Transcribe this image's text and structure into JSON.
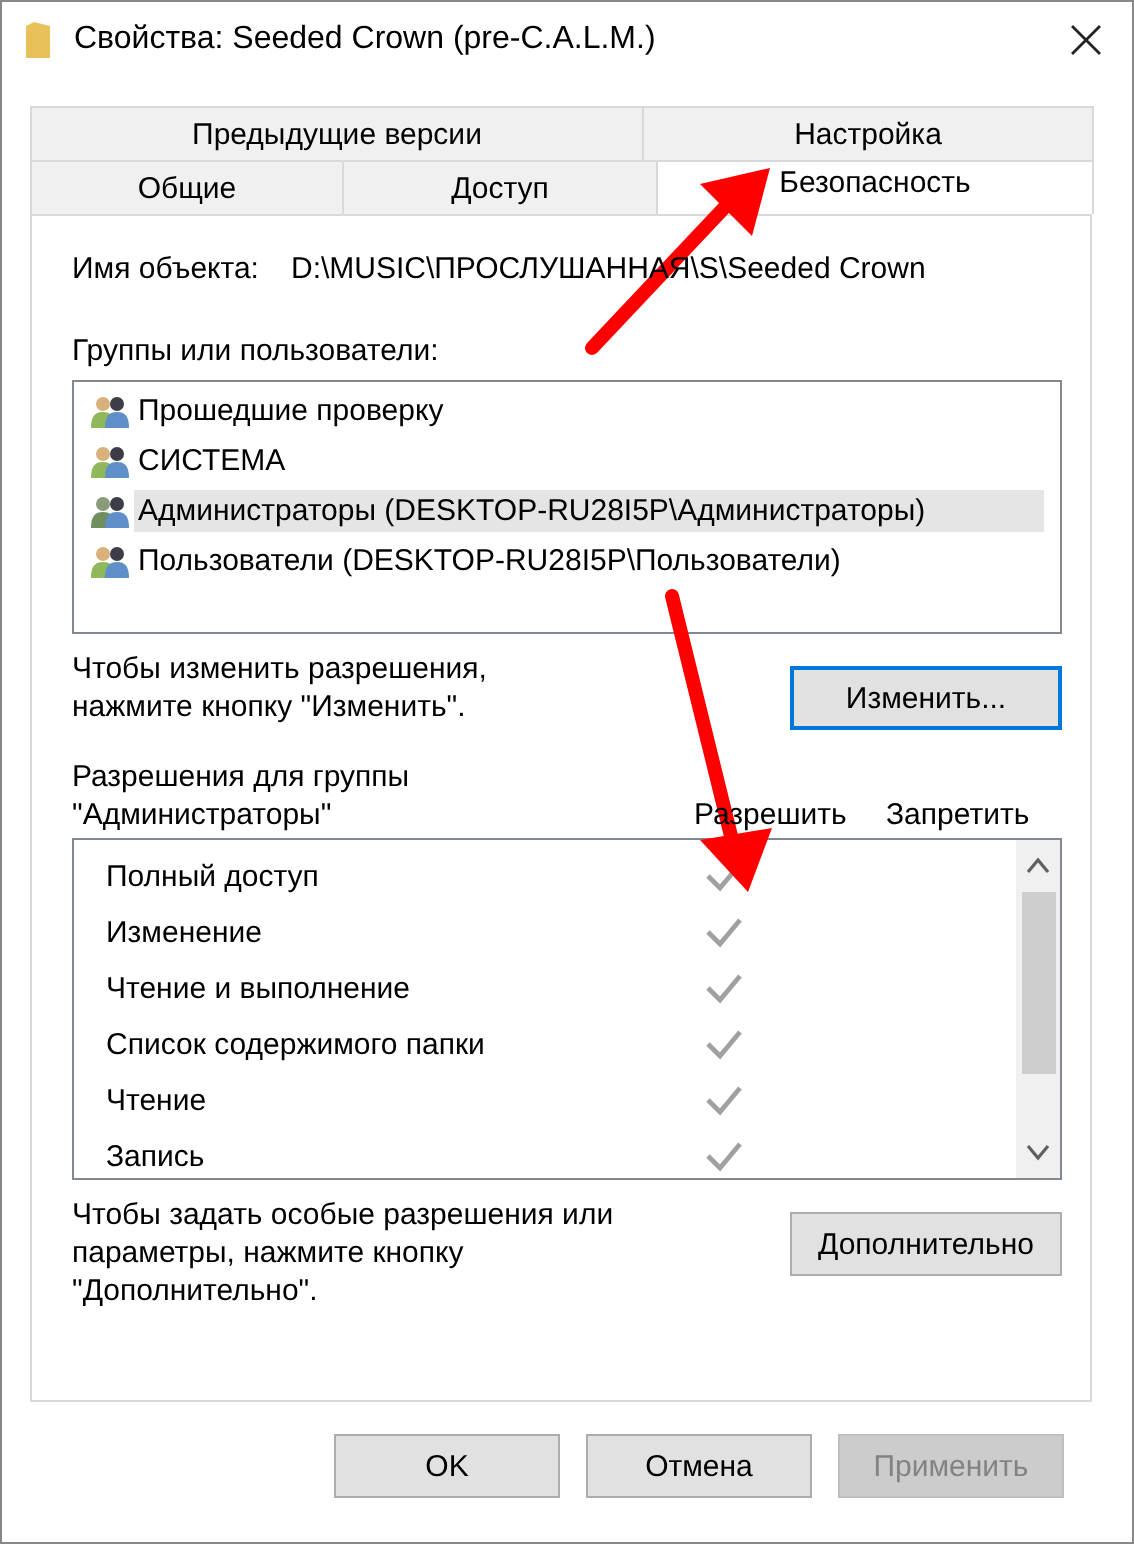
{
  "window": {
    "title": "Свойства: Seeded Crown (pre-C.A.L.M.)"
  },
  "tab_rows": [
    [
      {
        "label": "Предыдущие версии",
        "selected": false
      },
      {
        "label": "Настройка",
        "selected": false
      }
    ],
    [
      {
        "label": "Общие",
        "selected": false
      },
      {
        "label": "Доступ",
        "selected": false
      },
      {
        "label": "Безопасность",
        "selected": true
      }
    ]
  ],
  "object_name": {
    "label": "Имя объекта:",
    "value": "D:\\MUSIC\\ПРОСЛУШАННАЯ\\S\\Seeded Crown"
  },
  "groups": {
    "label": "Группы или пользователи:",
    "items": [
      {
        "name": "Прошедшие проверку",
        "selected": false
      },
      {
        "name": "СИСТЕМА",
        "selected": false
      },
      {
        "name": "Администраторы (DESKTOP-RU28I5P\\Администраторы)",
        "selected": true
      },
      {
        "name": "Пользователи (DESKTOP-RU28I5P\\Пользователи)",
        "selected": false
      }
    ]
  },
  "change_hint": "Чтобы изменить разрешения,\nнажмите кнопку \"Изменить\".",
  "change_button": {
    "label": "Изменить...",
    "focused": true
  },
  "permissions": {
    "label": "Разрешения для группы\n\"Администраторы\"",
    "columns": [
      "Разрешить",
      "Запретить"
    ],
    "rows": [
      {
        "name": "Полный доступ",
        "allow": true,
        "deny": false
      },
      {
        "name": "Изменение",
        "allow": true,
        "deny": false
      },
      {
        "name": "Чтение и выполнение",
        "allow": true,
        "deny": false
      },
      {
        "name": "Список содержимого папки",
        "allow": true,
        "deny": false
      },
      {
        "name": "Чтение",
        "allow": true,
        "deny": false
      },
      {
        "name": "Запись",
        "allow": true,
        "deny": false
      }
    ]
  },
  "advanced_hint": "Чтобы задать особые разрешения или\nпараметры, нажмите кнопку\n\"Дополнительно\".",
  "advanced_button": {
    "label": "Дополнительно",
    "disabled": false
  },
  "buttons": [
    {
      "label": "OK",
      "disabled": false
    },
    {
      "label": "Отмена",
      "disabled": false
    },
    {
      "label": "Применить",
      "disabled": true
    }
  ]
}
